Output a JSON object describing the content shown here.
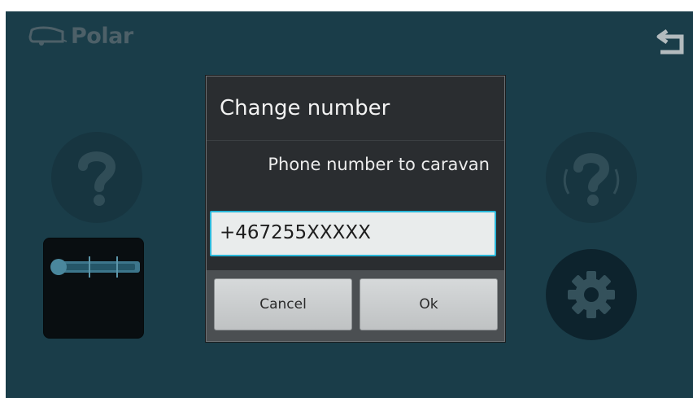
{
  "app": {
    "logo_text": "Polar"
  },
  "icons": {
    "logo": "caravan-logo-icon",
    "back": "back-arrow-icon",
    "help_left": "help-question-icon",
    "help_right": "help-signal-icon",
    "level": "level-gauge-icon",
    "settings": "gear-icon"
  },
  "dialog": {
    "title": "Change number",
    "message": "Phone number to caravan",
    "phone_value": "+467255XXXXX",
    "cancel_label": "Cancel",
    "ok_label": "Ok"
  },
  "colors": {
    "background": "#1f4654",
    "accent": "#2ab7d8",
    "dialog_bg": "#2a2d30"
  }
}
